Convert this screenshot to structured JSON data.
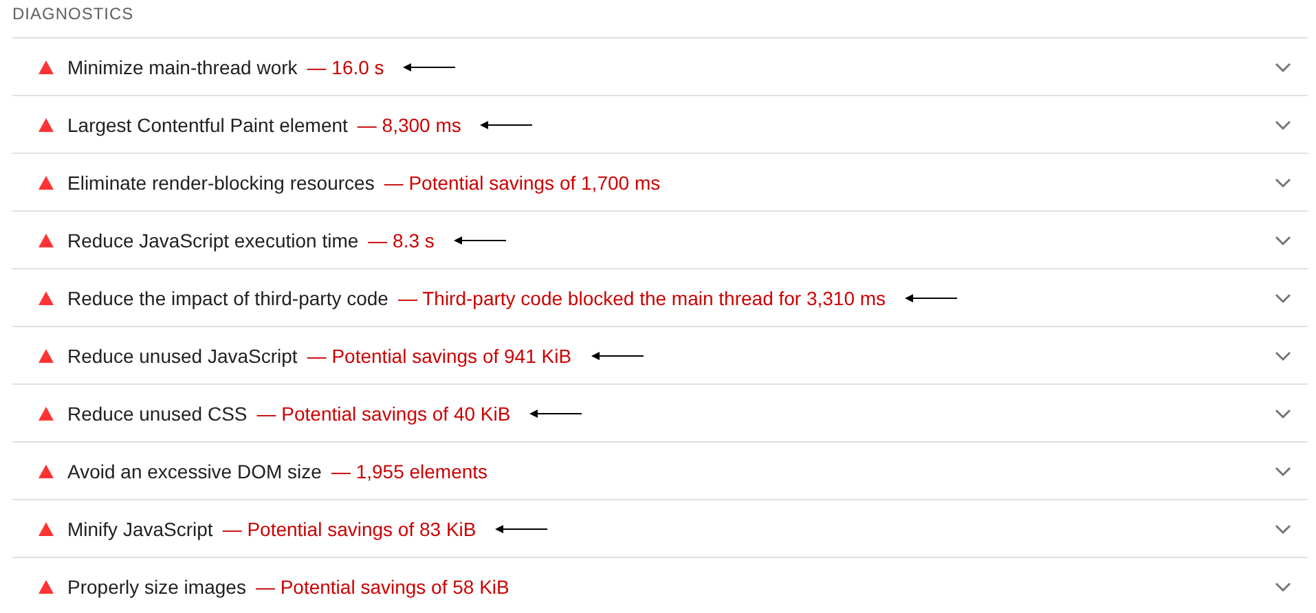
{
  "section": {
    "title": "DIAGNOSTICS"
  },
  "audits": [
    {
      "title": "Minimize main-thread work",
      "detail": "— 16.0 s",
      "expanded": false,
      "annotated": true
    },
    {
      "title": "Largest Contentful Paint element",
      "detail": "— 8,300 ms",
      "expanded": false,
      "annotated": true
    },
    {
      "title": "Eliminate render-blocking resources",
      "detail": "— Potential savings of 1,700 ms",
      "expanded": false,
      "annotated": false
    },
    {
      "title": "Reduce JavaScript execution time",
      "detail": "— 8.3 s",
      "expanded": false,
      "annotated": true
    },
    {
      "title": "Reduce the impact of third-party code",
      "detail": "— Third-party code blocked the main thread for 3,310 ms",
      "expanded": false,
      "annotated": true
    },
    {
      "title": "Reduce unused JavaScript",
      "detail": "— Potential savings of 941 KiB",
      "expanded": false,
      "annotated": true
    },
    {
      "title": "Reduce unused CSS",
      "detail": "— Potential savings of 40 KiB",
      "expanded": false,
      "annotated": true
    },
    {
      "title": "Avoid an excessive DOM size",
      "detail": "— 1,955 elements",
      "expanded": false,
      "annotated": false
    },
    {
      "title": "Minify JavaScript",
      "detail": "— Potential savings of 83 KiB",
      "expanded": false,
      "annotated": true
    },
    {
      "title": "Properly size images",
      "detail": "— Potential savings of 58 KiB",
      "expanded": false,
      "annotated": false
    }
  ]
}
